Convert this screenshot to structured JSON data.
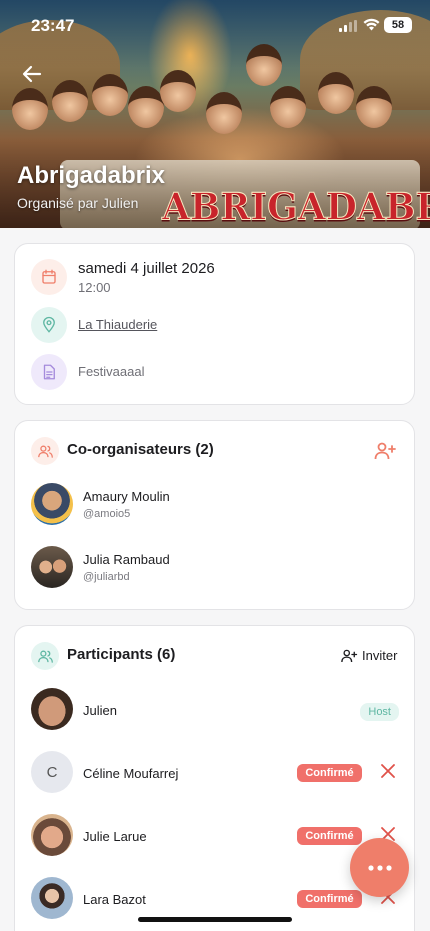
{
  "status": {
    "time": "23:47",
    "battery": "58"
  },
  "event": {
    "title": "Abrigadabrix",
    "organizer": "Organisé par Julien",
    "logo_text": "ABRIGADABRIX",
    "date": "samedi 4 juillet 2026",
    "time": "12:00",
    "location": "La Thiauderie",
    "description": "Festivaaaal"
  },
  "coorganizers": {
    "title": "Co-organisateurs (2)",
    "people": [
      {
        "name": "Amaury Moulin",
        "handle": "@amoio5"
      },
      {
        "name": "Julia Rambaud",
        "handle": "@juliarbd"
      }
    ]
  },
  "participants": {
    "title": "Participants (6)",
    "invite_label": "Inviter",
    "people": [
      {
        "name": "Julien",
        "badge": "Host",
        "initial": ""
      },
      {
        "name": "Céline Moufarrej",
        "badge": "Confirmé",
        "initial": "C"
      },
      {
        "name": "Julie Larue",
        "badge": "Confirmé",
        "initial": ""
      },
      {
        "name": "Lara Bazot",
        "badge": "Confirmé",
        "initial": ""
      }
    ]
  },
  "colors": {
    "accent": "#ef7e6a",
    "confirm": "#f0706a",
    "teal": "#5fb7a3",
    "purple": "#a58bdc"
  }
}
